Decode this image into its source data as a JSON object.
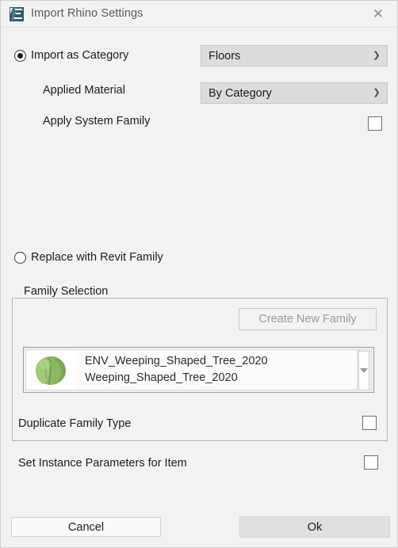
{
  "window": {
    "title": "Import Rhino Settings",
    "icon": "app-logo-icon",
    "close_label": "✕"
  },
  "import_as_category": {
    "radio_label": "Import as Category",
    "radio_selected": true,
    "category_value": "Floors",
    "applied_material_label": "Applied Material",
    "applied_material_value": "By Category",
    "apply_system_family_label": "Apply System Family",
    "apply_system_family_checked": false
  },
  "replace_with_revit_family": {
    "radio_label": "Replace with Revit Family",
    "radio_selected": false
  },
  "family_selection": {
    "group_title": "Family Selection",
    "create_new_family_label": "Create New Family",
    "create_new_family_enabled": false,
    "item": {
      "thumbnail": "tree-thumbnail-icon",
      "line1": "ENV_Weeping_Shaped_Tree_2020",
      "line2": "Weeping_Shaped_Tree_2020"
    },
    "duplicate_family_type_label": "Duplicate Family Type",
    "duplicate_family_type_checked": false
  },
  "set_instance_parameters": {
    "label": "Set Instance Parameters for Item",
    "checked": false
  },
  "footer": {
    "cancel_label": "Cancel",
    "ok_label": "Ok"
  },
  "colors": {
    "dialog_background": "#f2f2f2",
    "combo_background": "#dcdcdc",
    "ok_button_background": "#e0e0e0",
    "title_text": "#5a5a5a",
    "body_text": "#1c1c1c",
    "disabled_text": "#9b9b9b",
    "logo_teal": "#2e5f6b",
    "tree_green": "#8fbc6a"
  }
}
